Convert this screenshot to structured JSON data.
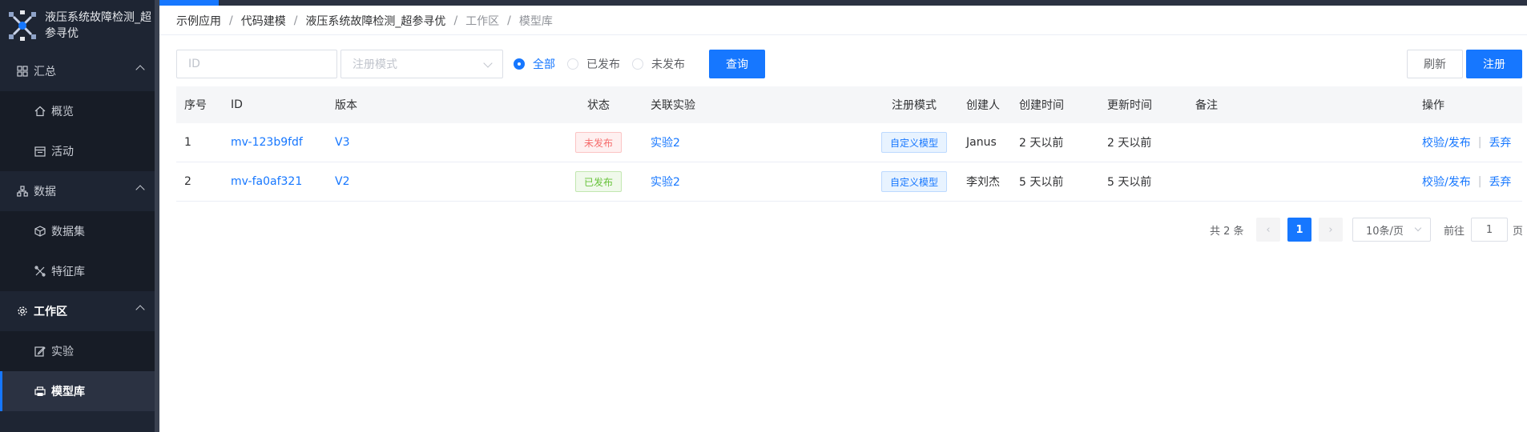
{
  "app": {
    "title": "液压系统故障检测_超参寻优"
  },
  "sidebar": {
    "groups": [
      {
        "label": "汇总",
        "icon": "grid-icon",
        "items": [
          {
            "label": "概览",
            "icon": "home-icon"
          },
          {
            "label": "活动",
            "icon": "calendar-icon"
          }
        ]
      },
      {
        "label": "数据",
        "icon": "hierarchy-icon",
        "items": [
          {
            "label": "数据集",
            "icon": "cube-icon"
          },
          {
            "label": "特征库",
            "icon": "tools-icon"
          }
        ]
      },
      {
        "label": "工作区",
        "icon": "gear-icon",
        "items": [
          {
            "label": "实验",
            "icon": "edit-icon"
          },
          {
            "label": "模型库",
            "icon": "printer-icon"
          }
        ]
      }
    ]
  },
  "breadcrumb": [
    "示例应用",
    "代码建模",
    "液压系统故障检测_超参寻优",
    "工作区",
    "模型库"
  ],
  "filters": {
    "id_placeholder": "ID",
    "mode_placeholder": "注册模式",
    "radios": [
      "全部",
      "已发布",
      "未发布"
    ],
    "query_label": "查询",
    "refresh_label": "刷新",
    "register_label": "注册"
  },
  "table": {
    "headers": {
      "index": "序号",
      "id": "ID",
      "version": "版本",
      "status": "状态",
      "experiment": "关联实验",
      "mode": "注册模式",
      "creator": "创建人",
      "created": "创建时间",
      "updated": "更新时间",
      "remark": "备注",
      "ops": "操作"
    },
    "rows": [
      {
        "index": "1",
        "id": "mv-123b9fdf",
        "version": "V3",
        "status": "未发布",
        "experiment": "实验2",
        "mode": "自定义模型",
        "creator": "Janus",
        "created": "2 天以前",
        "updated": "2 天以前",
        "remark": "",
        "op1": "校验/发布",
        "op2": "丢弃"
      },
      {
        "index": "2",
        "id": "mv-fa0af321",
        "version": "V2",
        "status": "已发布",
        "experiment": "实验2",
        "mode": "自定义模型",
        "creator": "李刘杰",
        "created": "5 天以前",
        "updated": "5 天以前",
        "remark": "",
        "op1": "校验/发布",
        "op2": "丢弃"
      }
    ],
    "op_separator": "|"
  },
  "pagination": {
    "total": "共 2 条",
    "prev": "‹",
    "current": "1",
    "next": "›",
    "page_size": "10条/页",
    "goto_prefix": "前往",
    "goto_value": "1",
    "goto_suffix": "页"
  },
  "colors": {
    "primary": "#1677ff",
    "sidebar_bg": "#1e2533",
    "danger": "#f56c6c",
    "success": "#67c23a"
  }
}
